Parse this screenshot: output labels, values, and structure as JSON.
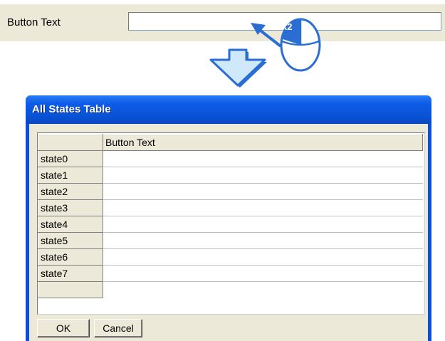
{
  "property": {
    "label": "Button Text",
    "value": ""
  },
  "annotation": {
    "click_count": "x2",
    "arrow_color": "#2a6ed4",
    "down_arrow_fill": "#cfe9fb"
  },
  "dialog": {
    "title": "All States Table",
    "column_header": "Button Text",
    "rows": [
      {
        "state": "state0",
        "text": ""
      },
      {
        "state": "state1",
        "text": ""
      },
      {
        "state": "state2",
        "text": ""
      },
      {
        "state": "state3",
        "text": ""
      },
      {
        "state": "state4",
        "text": ""
      },
      {
        "state": "state5",
        "text": ""
      },
      {
        "state": "state6",
        "text": ""
      },
      {
        "state": "state7",
        "text": ""
      }
    ],
    "ok_label": "OK",
    "cancel_label": "Cancel"
  }
}
